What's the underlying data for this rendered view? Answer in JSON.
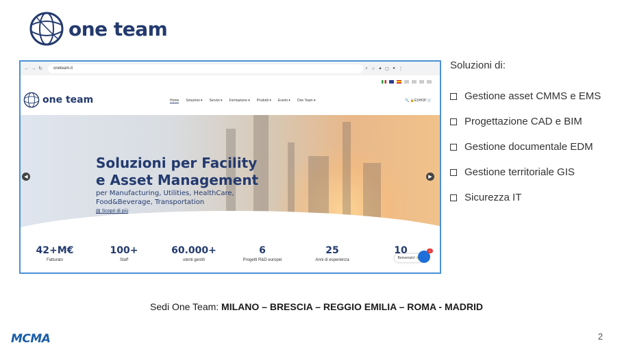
{
  "slide": {
    "logo_text": "one team",
    "solutions_title": "Soluzioni di:",
    "solutions": [
      "Gestione asset CMMS e EMS",
      "Progettazione CAD e BIM",
      "Gestione documentale EDM",
      "Gestione territoriale GIS",
      "Sicurezza IT"
    ],
    "sedi_label": "Sedi One Team:",
    "sedi_cities": " MILANO – BRESCIA – REGGIO EMILIA – ROMA - MADRID",
    "footer_logo": "MCMA",
    "page_number": "2"
  },
  "browser": {
    "url": "oneteam.it"
  },
  "site": {
    "brand": "one team",
    "nav": [
      "Home",
      "Soluzioni ▾",
      "Servizi ▾",
      "Formazione ▾",
      "Prodotti ▾",
      "Eventi ▾",
      "One Team ▾"
    ],
    "eshop": "🔍 🔒ESHOP 🛒",
    "hero_title_1": "Soluzioni per Facility",
    "hero_title_2": "e Asset Management",
    "hero_sub": "per Manufacturing, Utilities, HealthCare, Food&Beverage, Transportation",
    "hero_link": "Scopri di più",
    "stats": [
      {
        "num": "42+M€",
        "label": "Fatturato"
      },
      {
        "num": "100+",
        "label": "Staff"
      },
      {
        "num": "60.000+",
        "label": "utenti gestiti"
      },
      {
        "num": "6",
        "label": "Progetti R&D europei"
      },
      {
        "num": "25",
        "label": "Anni di esperienza"
      },
      {
        "num": "10",
        "label": ""
      }
    ],
    "chat_text": "Benvenuto! 👋",
    "chat_badge": "1"
  },
  "colors": {
    "brand_navy": "#233a6e",
    "frame_blue": "#4a90d9",
    "mcma_blue": "#1b5ea8"
  }
}
